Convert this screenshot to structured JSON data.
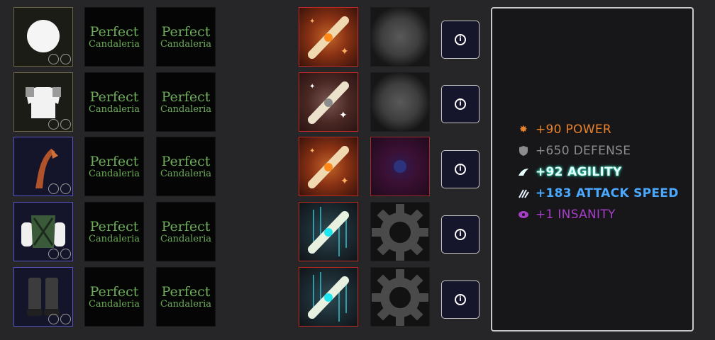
{
  "rows": [
    {
      "item_icon": "white-orb-icon",
      "item_frame": "tan",
      "perk1": {
        "line1": "Perfect",
        "line2": "Candaleria"
      },
      "perk2": {
        "line1": "Perfect",
        "line2": "Candaleria"
      },
      "scroll": "orange-scroll-icon",
      "gem": "blurred-gem-icon"
    },
    {
      "item_icon": "white-shirt-icon",
      "item_frame": "tan",
      "perk1": {
        "line1": "Perfect",
        "line2": "Candaleria"
      },
      "perk2": {
        "line1": "Perfect",
        "line2": "Candaleria"
      },
      "scroll": "white-scroll-icon",
      "gem": "blurred-gem-icon"
    },
    {
      "item_icon": "orange-weapon-icon",
      "item_frame": "purple",
      "perk1": {
        "line1": "Perfect",
        "line2": "Candaleria"
      },
      "perk2": {
        "line1": "Perfect",
        "line2": "Candaleria"
      },
      "scroll": "orange-scroll-icon",
      "gem": "purple-gem-icon"
    },
    {
      "item_icon": "green-armor-icon",
      "item_frame": "purple",
      "perk1": {
        "line1": "Perfect",
        "line2": "Candaleria"
      },
      "perk2": {
        "line1": "Perfect",
        "line2": "Candaleria"
      },
      "scroll": "cyan-scroll-icon",
      "gem": "gear-icon"
    },
    {
      "item_icon": "dark-boots-icon",
      "item_frame": "purple",
      "perk1": {
        "line1": "Perfect",
        "line2": "Candaleria"
      },
      "perk2": {
        "line1": "Perfect",
        "line2": "Candaleria"
      },
      "scroll": "cyan-scroll-icon",
      "gem": "gear-icon"
    }
  ],
  "info_icon": "info-icon",
  "stats": [
    {
      "label": "+90 POWER",
      "color": "#e8822c",
      "icon": "burst-icon"
    },
    {
      "label": "+650 DEFENSE",
      "color": "#8c8c8c",
      "icon": "shield-icon"
    },
    {
      "label": "+92 AGILITY",
      "color": "#e6ffff",
      "icon": "wing-icon"
    },
    {
      "label": "+183 ATTACK SPEED",
      "color": "#4aa8ff",
      "icon": "claw-icon"
    },
    {
      "label": "+1 INSANITY",
      "color": "#a63ec8",
      "icon": "eye-icon"
    }
  ]
}
